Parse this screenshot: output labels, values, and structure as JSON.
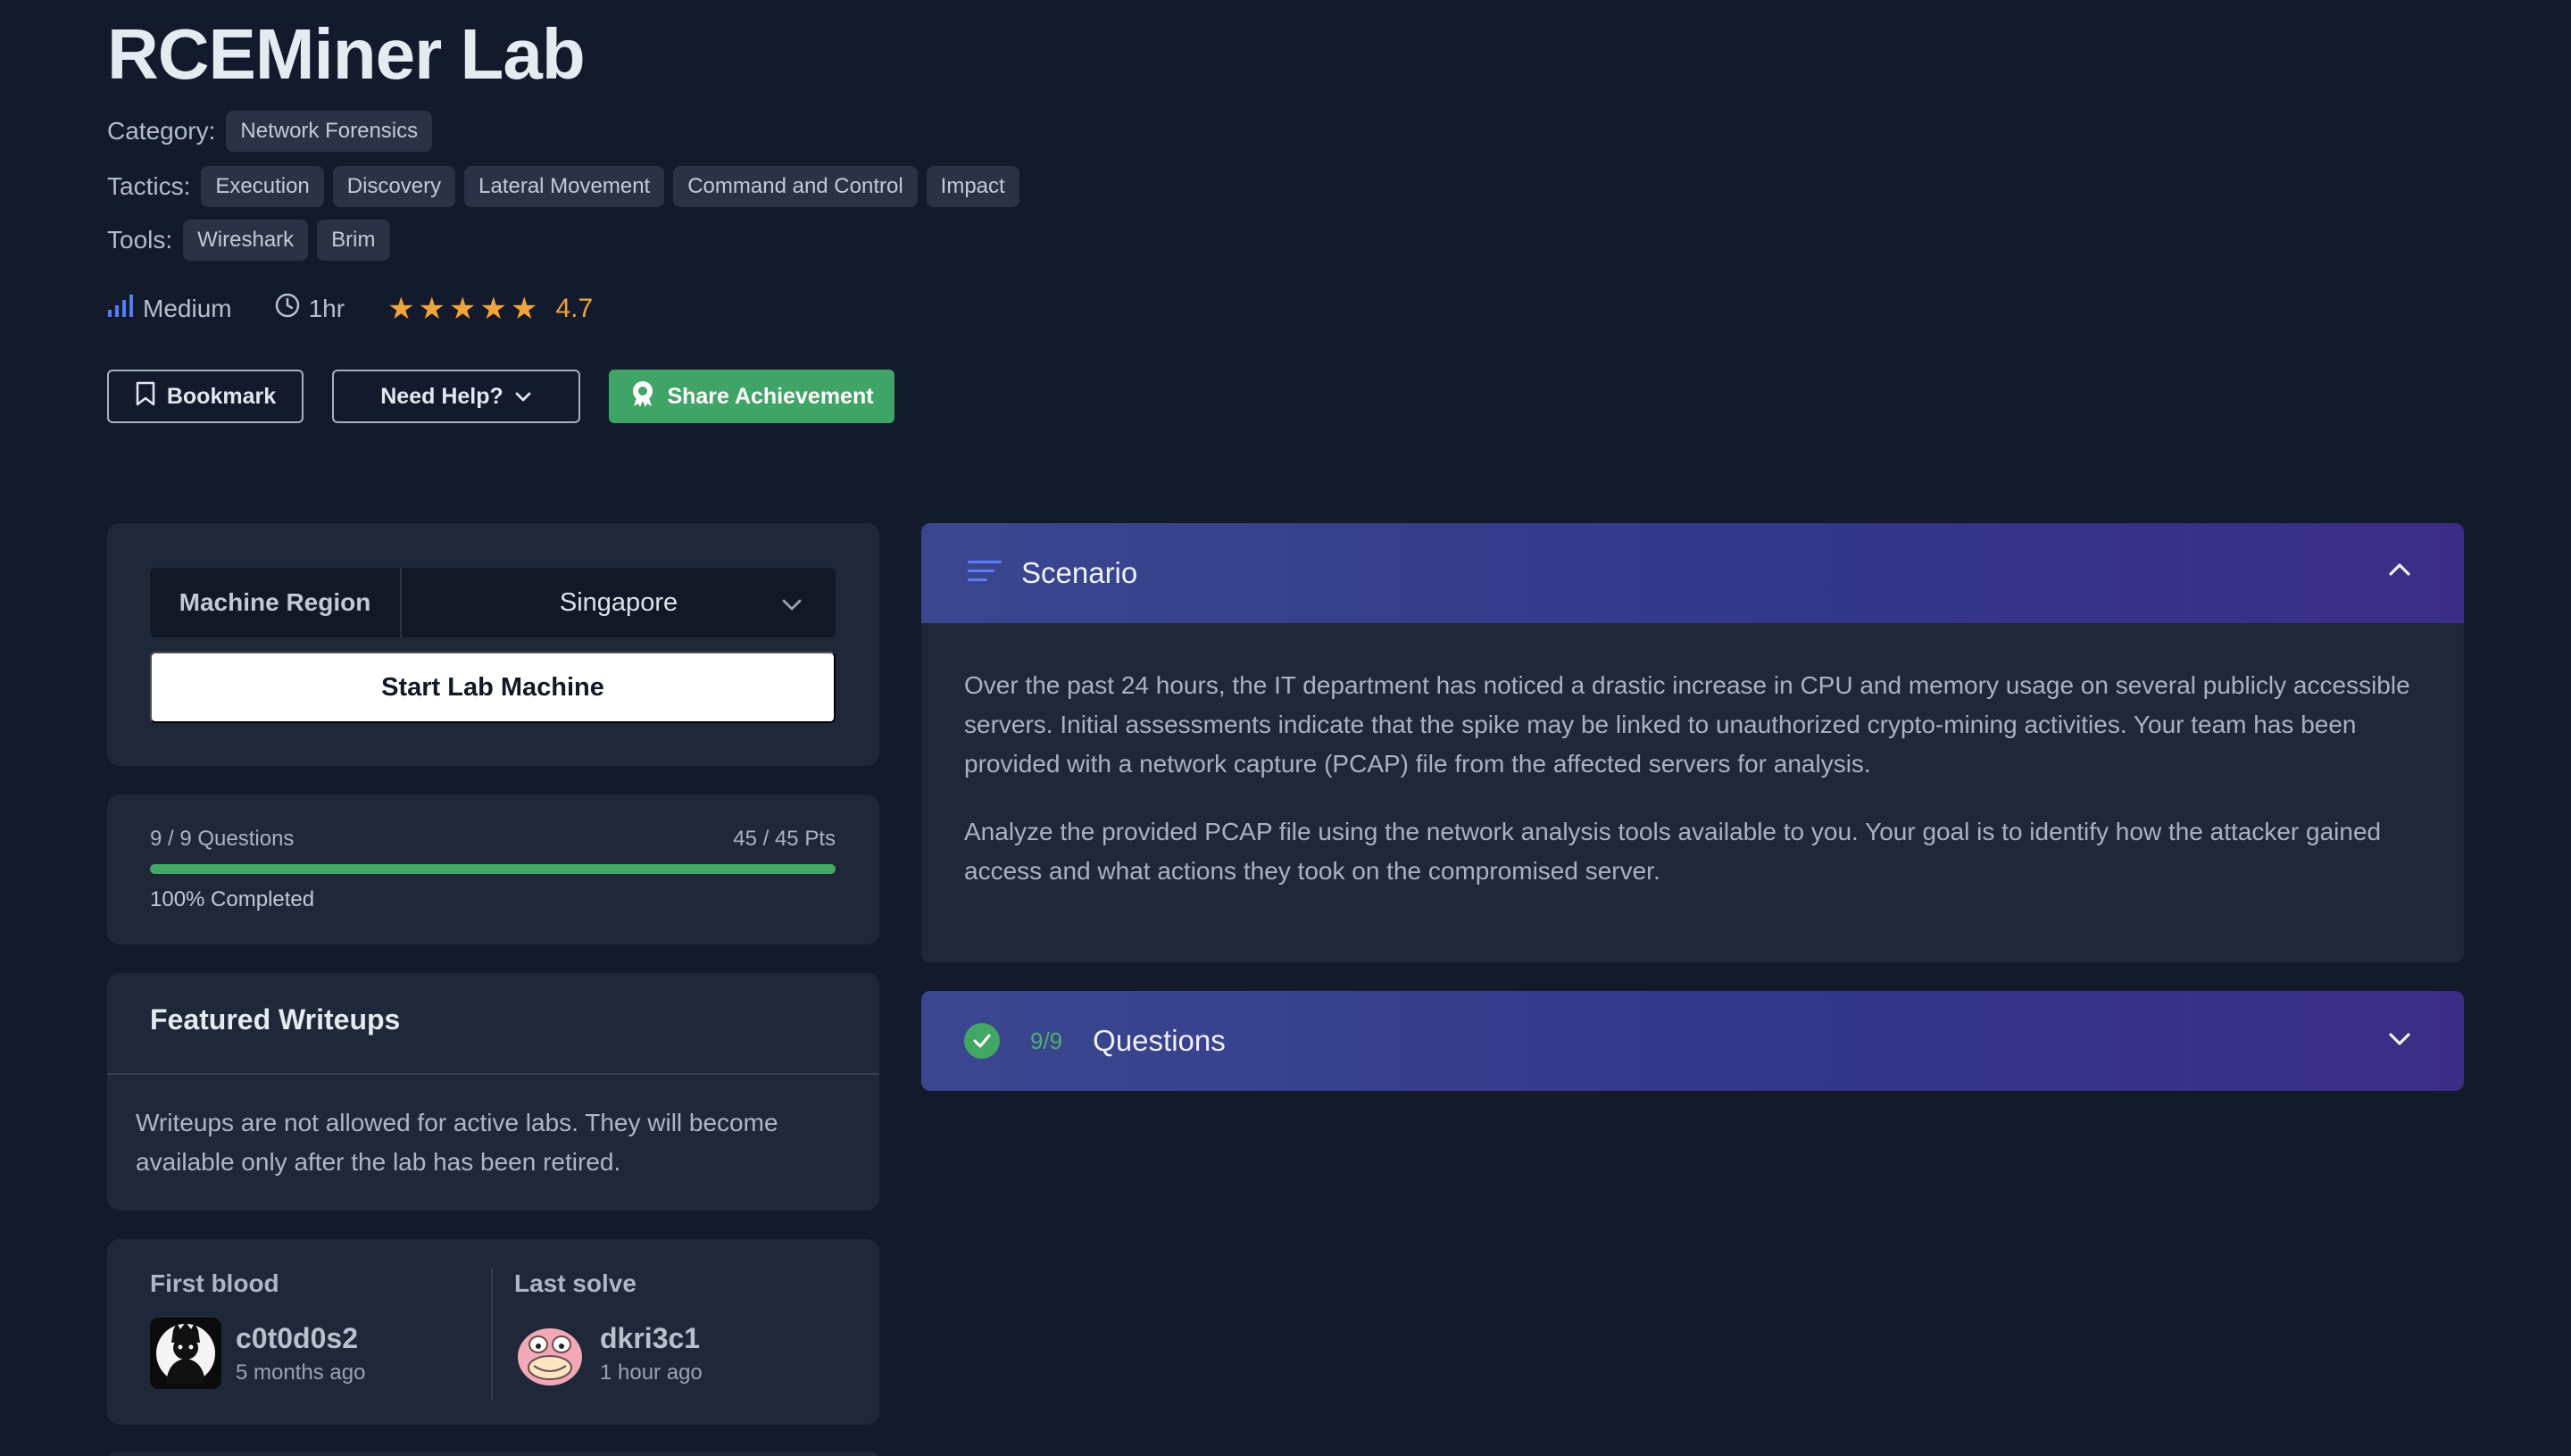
{
  "lab": {
    "title": "RCEMiner Lab",
    "category_label": "Category:",
    "category": "Network Forensics",
    "tactics_label": "Tactics:",
    "tactics": [
      "Execution",
      "Discovery",
      "Lateral Movement",
      "Command and Control",
      "Impact"
    ],
    "tools_label": "Tools:",
    "tools": [
      "Wireshark",
      "Brim"
    ],
    "difficulty": "Medium",
    "duration": "1hr",
    "rating": "4.7",
    "stars": 5
  },
  "actions": {
    "bookmark": "Bookmark",
    "need_help": "Need Help?",
    "share": "Share Achievement"
  },
  "machine": {
    "region_label": "Machine Region",
    "region_value": "Singapore",
    "start_label": "Start Lab Machine"
  },
  "progress": {
    "questions": "9 / 9 Questions",
    "points": "45 / 45 Pts",
    "completed_text": "100% Completed",
    "fraction": 1.0
  },
  "writeups": {
    "title": "Featured Writeups",
    "text": "Writeups are not allowed for active labs. They will become available only after the lab has been retired."
  },
  "solves": {
    "first_blood_label": "First blood",
    "first_blood_user": "c0t0d0s2",
    "first_blood_time": "5 months ago",
    "last_solve_label": "Last solve",
    "last_solve_user": "dkri3c1",
    "last_solve_time": "1 hour ago"
  },
  "scenario": {
    "title": "Scenario",
    "paragraphs": [
      "Over the past 24 hours, the IT department has noticed a drastic increase in CPU and memory usage on several publicly accessible servers. Initial assessments indicate that the spike may be linked to unauthorized crypto-mining activities. Your team has been provided with a network capture (PCAP) file from the affected servers for analysis.",
      "Analyze the provided PCAP file using the network analysis tools available to you. Your goal is to identify how the attacker gained access and what actions they took on the compromised server."
    ]
  },
  "questions": {
    "count": "9/9",
    "title": "Questions"
  },
  "colors": {
    "background": "#131a2c",
    "card": "#1f2839",
    "accent_green": "#42a765",
    "star": "#f1a43b",
    "header_gradient_start": "#3a478f",
    "header_gradient_end": "#3b2d86"
  }
}
